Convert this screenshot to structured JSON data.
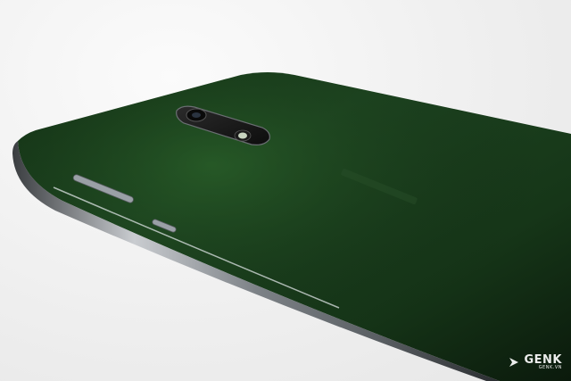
{
  "watermark": {
    "brand": "GENK",
    "site": "GENK.VN"
  },
  "colors": {
    "background": "#efefef",
    "phone_back_dark": "#0c1a0e",
    "phone_back_green": "#1f4a22",
    "frame_edge": "#8a8f94"
  },
  "icons": {
    "watermark_mark": "chevron-arrow-icon"
  }
}
